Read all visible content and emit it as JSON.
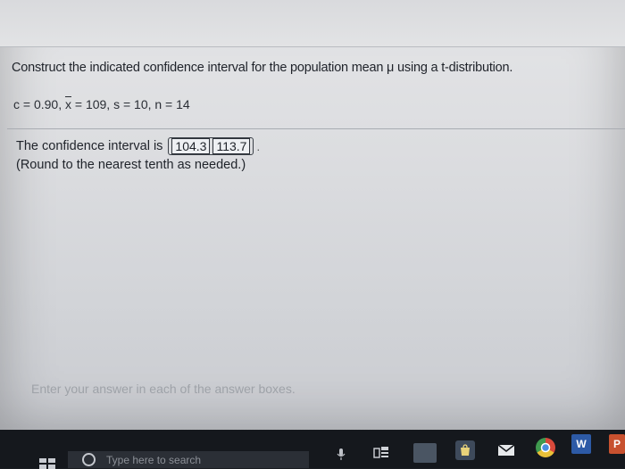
{
  "problem": {
    "question": "Construct the indicated confidence interval for the population mean μ using a t-distribution.",
    "givens_prefix": "c = 0.90, ",
    "xbar_symbol": "x",
    "givens_suffix": " = 109, s = 10, n = 14"
  },
  "answer": {
    "intro": "The confidence interval is",
    "lower": "104.3",
    "upper": "113.7",
    "round_note": "(Round to the nearest tenth as needed.)"
  },
  "status": {
    "instruction": "Enter your answer in each of the answer boxes."
  },
  "taskbar": {
    "search_placeholder": "Type here to search",
    "word_label": "W",
    "ppt_label": "P"
  }
}
